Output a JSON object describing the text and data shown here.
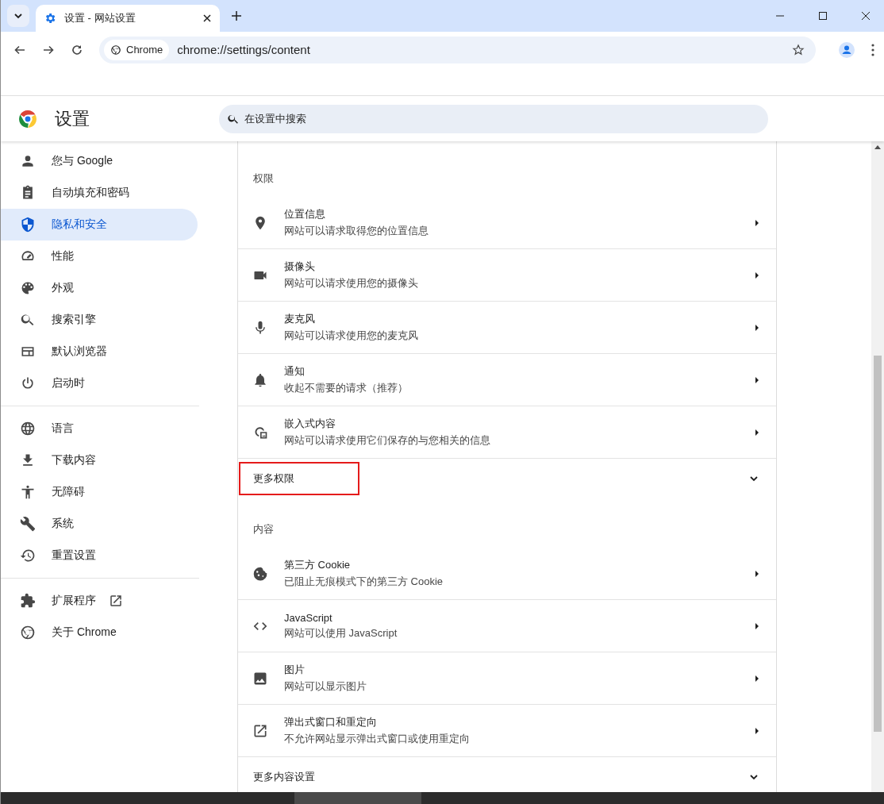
{
  "tabs": [
    {
      "title": "设置 - 网站设置",
      "selected": true
    }
  ],
  "address_bar": {
    "chip": "Chrome",
    "url": "chrome://settings/content"
  },
  "header": {
    "title": "设置",
    "search": {
      "placeholder": "在设置中搜索"
    }
  },
  "sidebar": {
    "groups": [
      [
        {
          "label": "您与 Google",
          "kind": "person",
          "selected": false
        },
        {
          "label": "自动填充和密码",
          "kind": "clipboard",
          "selected": false
        },
        {
          "label": "隐私和安全",
          "kind": "shield",
          "selected": true
        },
        {
          "label": "性能",
          "kind": "gauge",
          "selected": false
        },
        {
          "label": "外观",
          "kind": "palette",
          "selected": false
        },
        {
          "label": "搜索引擎",
          "kind": "search",
          "selected": false
        },
        {
          "label": "默认浏览器",
          "kind": "browser",
          "selected": false
        },
        {
          "label": "启动时",
          "kind": "power",
          "selected": false
        }
      ],
      [
        {
          "label": "语言",
          "kind": "globe",
          "selected": false
        },
        {
          "label": "下载内容",
          "kind": "download",
          "selected": false
        },
        {
          "label": "无障碍",
          "kind": "accessibility",
          "selected": false
        },
        {
          "label": "系统",
          "kind": "wrench",
          "selected": false
        },
        {
          "label": "重置设置",
          "kind": "history",
          "selected": false
        }
      ],
      [
        {
          "label": "扩展程序",
          "kind": "puzzle",
          "selected": false,
          "external": true
        },
        {
          "label": "关于 Chrome",
          "kind": "chrome",
          "selected": false
        }
      ]
    ]
  },
  "sections": [
    {
      "heading": "权限",
      "rows": [
        {
          "kind": "pin",
          "title": "位置信息",
          "subtitle": "网站可以请求取得您的位置信息"
        },
        {
          "kind": "camera",
          "title": "摄像头",
          "subtitle": "网站可以请求使用您的摄像头"
        },
        {
          "kind": "mic",
          "title": "麦克风",
          "subtitle": "网站可以请求使用您的麦克风"
        },
        {
          "kind": "bell",
          "title": "通知",
          "subtitle": "收起不需要的请求（推荐）"
        },
        {
          "kind": "embed",
          "title": "嵌入式内容",
          "subtitle": "网站可以请求使用它们保存的与您相关的信息"
        },
        {
          "kind": "expand",
          "title": "更多权限",
          "expanded": false,
          "highlighted": true
        }
      ]
    },
    {
      "heading": "内容",
      "rows": [
        {
          "kind": "cookie",
          "title": "第三方 Cookie",
          "subtitle": "已阻止无痕模式下的第三方 Cookie"
        },
        {
          "kind": "code",
          "title": "JavaScript",
          "subtitle": "网站可以使用 JavaScript"
        },
        {
          "kind": "image",
          "title": "图片",
          "subtitle": "网站可以显示图片"
        },
        {
          "kind": "popup",
          "title": "弹出式窗口和重定向",
          "subtitle": "不允许网站显示弹出式窗口或使用重定向"
        },
        {
          "kind": "expand",
          "title": "更多内容设置",
          "expanded": false,
          "highlighted": false
        }
      ]
    }
  ]
}
